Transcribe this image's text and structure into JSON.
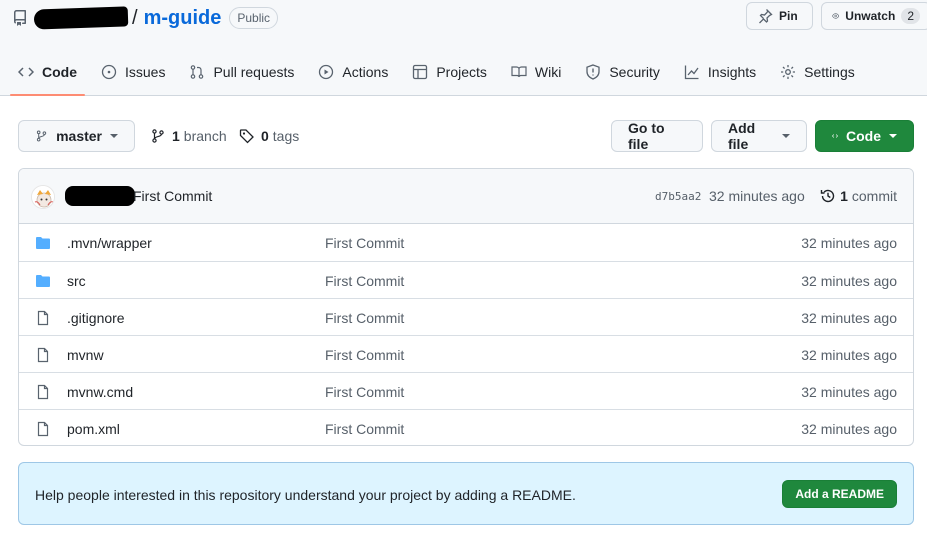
{
  "repo": {
    "name": "m-guide",
    "visibility": "Public",
    "pin_label": "Pin",
    "unwatch_label": "Unwatch",
    "watch_count": "2"
  },
  "tabs": [
    {
      "label": "Code",
      "icon": "code-icon",
      "active": true
    },
    {
      "label": "Issues",
      "icon": "issue-opened-icon"
    },
    {
      "label": "Pull requests",
      "icon": "git-pull-request-icon"
    },
    {
      "label": "Actions",
      "icon": "play-icon"
    },
    {
      "label": "Projects",
      "icon": "table-icon"
    },
    {
      "label": "Wiki",
      "icon": "book-icon"
    },
    {
      "label": "Security",
      "icon": "shield-icon"
    },
    {
      "label": "Insights",
      "icon": "graph-icon"
    },
    {
      "label": "Settings",
      "icon": "gear-icon"
    }
  ],
  "branch_bar": {
    "branch": "master",
    "branch_count": "1",
    "branch_label": "branch",
    "tag_count": "0",
    "tag_label": "tags",
    "go_to_file": "Go to file",
    "add_file": "Add file",
    "code": "Code"
  },
  "commit": {
    "message": "First Commit",
    "sha": "d7b5aa2",
    "age": "32 minutes ago",
    "count": "1",
    "count_label": "commit"
  },
  "files": [
    {
      "name": ".mvn/wrapper",
      "type": "dir",
      "message": "First Commit",
      "age": "32 minutes ago"
    },
    {
      "name": "src",
      "type": "dir",
      "message": "First Commit",
      "age": "32 minutes ago"
    },
    {
      "name": ".gitignore",
      "type": "file",
      "message": "First Commit",
      "age": "32 minutes ago"
    },
    {
      "name": "mvnw",
      "type": "file",
      "message": "First Commit",
      "age": "32 minutes ago"
    },
    {
      "name": "mvnw.cmd",
      "type": "file",
      "message": "First Commit",
      "age": "32 minutes ago"
    },
    {
      "name": "pom.xml",
      "type": "file",
      "message": "First Commit",
      "age": "32 minutes ago"
    }
  ],
  "readme_banner": {
    "text": "Help people interested in this repository understand your project by adding a README.",
    "button": "Add a README"
  },
  "colors": {
    "accent_link": "#0969da",
    "primary_green": "#1f883d",
    "active_tab_underline": "#fd8c73",
    "folder": "#54aeff",
    "banner_bg": "#ddf4ff"
  }
}
